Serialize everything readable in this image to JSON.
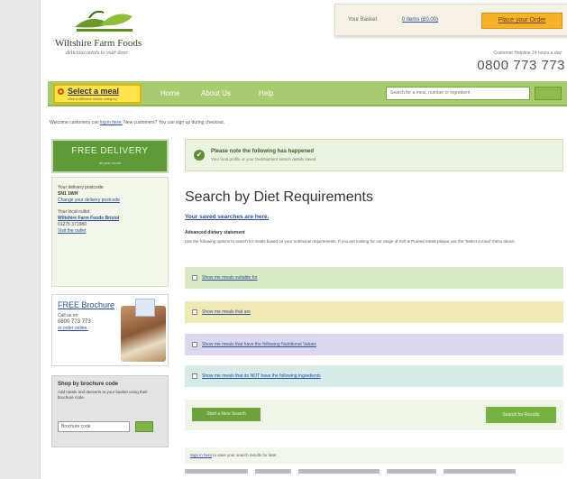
{
  "header": {
    "logo_name": "Wiltshire Farm Foods",
    "logo_tagline": "delicious meals to your door",
    "basket_label": "Your Basket",
    "basket_items": "0 items (£0.00)",
    "place_order_label": "Place your Order",
    "phone_label": "Customer Helpline 24 hours a day",
    "phone": "0800 773 773"
  },
  "nav": {
    "select_meal_title": "Select a meal",
    "select_meal_sub": "click a different meals category",
    "links": [
      "Home",
      "About Us",
      "Help"
    ],
    "search_placeholder": "Search for a meal, number or ingredient"
  },
  "welcome": {
    "text_before": "Welcome customers can",
    "link": "log in here.",
    "text_after": "New customers? You can sign up during checkout."
  },
  "free_delivery": {
    "title": "FREE DELIVERY",
    "subtitle": "all year round"
  },
  "delivery_box": {
    "postcode_label": "Your delivery postcode:",
    "postcode": "SN1 1WH",
    "change_link": "Change your delivery postcode",
    "outlet_label": "Your local outlet:",
    "outlet_name": "Wiltshire Farm Foods Bristol",
    "outlet_phone": "01275 371980",
    "visit_link": "Visit the outlet"
  },
  "brochure": {
    "title": "FREE Brochure",
    "call_text": "Call us on",
    "phone": "0800 773 773",
    "order_text": "or order online."
  },
  "shop_code": {
    "title": "Shop by brochure code",
    "description": "Add meals and desserts to your basket using their brochure code.",
    "input_placeholder": "Brochure code"
  },
  "alert": {
    "title": "Please note the following has happened",
    "subtitle": "Your food profile or your Diet/Nutrient search details saved"
  },
  "main": {
    "heading": "Search by Diet Requirements",
    "saved_link": "Your saved searches are here.",
    "sub_heading": "Advanced dietary statement",
    "description": "Use the following options to search for meals based on your nutritional requirements. If you are looking for our range of Soft & Pureed meals please use the 'Select a meal' menu above.",
    "options": [
      "Show me meals suitable for",
      "Show me meals that are",
      "Show me meals that have the following Nutritional Values",
      "Show me meals that do NOT have the following Ingredients"
    ],
    "start_new_label": "Start a New Search",
    "search_results_label": "Search for Results",
    "save_text_link": "Sign in here",
    "save_text_rest": "to save your search results for later."
  },
  "colors": {
    "nav_green": "#a9cb6f",
    "delivery_green": "#5e9b37",
    "button_orange": "#f6b32a",
    "select_yellow": "#ffe34a"
  }
}
